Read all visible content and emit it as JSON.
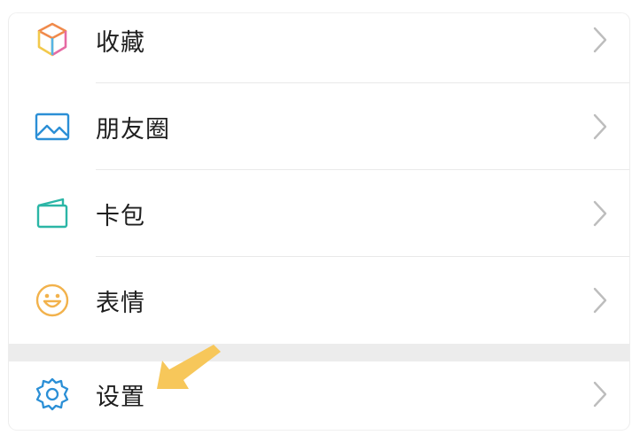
{
  "menu": {
    "items": [
      {
        "label": "收藏",
        "icon": "favorites-cube-icon"
      },
      {
        "label": "朋友圈",
        "icon": "moments-image-icon"
      },
      {
        "label": "卡包",
        "icon": "card-wallet-icon"
      },
      {
        "label": "表情",
        "icon": "smiley-face-icon"
      }
    ],
    "settings": {
      "label": "设置",
      "icon": "gear-icon"
    }
  },
  "annotation": {
    "pointer": "yellow-arrow-pointing-to-settings",
    "color": "#f7c75a"
  },
  "colors": {
    "icon_blue": "#2b8fd6",
    "chevron": "#bdbdbd",
    "separator_band": "#ececec"
  }
}
